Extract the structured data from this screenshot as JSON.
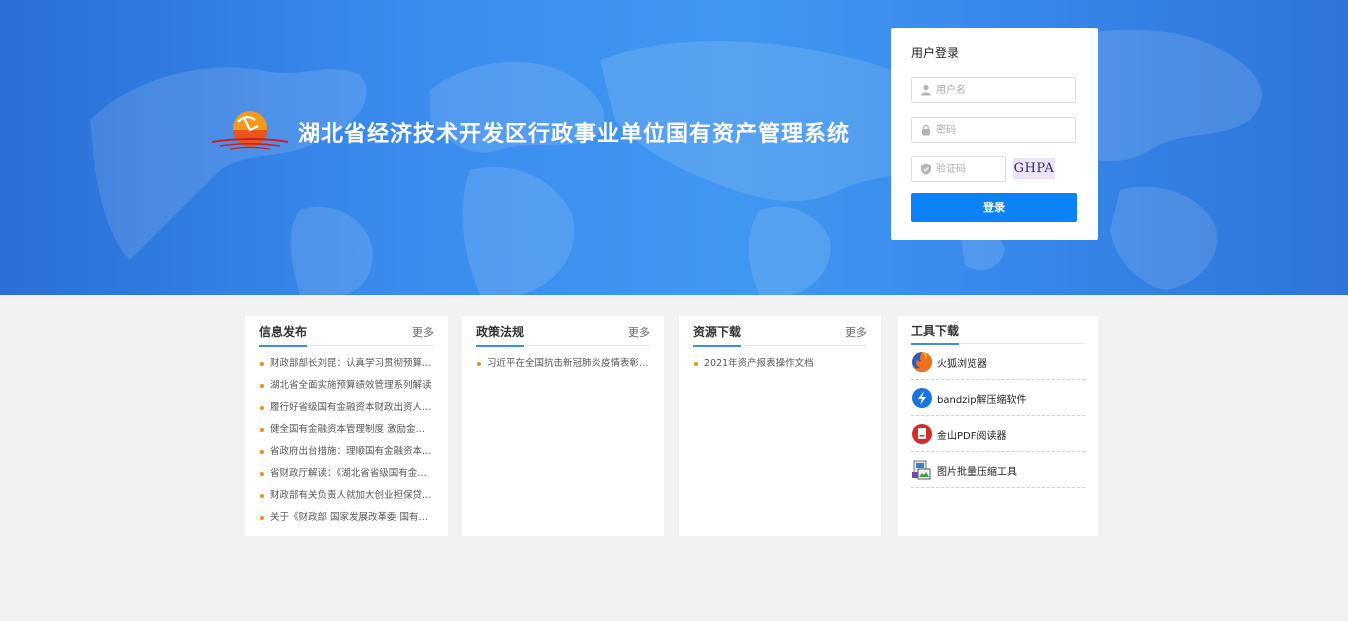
{
  "header": {
    "system_title": "湖北省经济技术开发区行政事业单位国有资产管理系统"
  },
  "login": {
    "title": "用户登录",
    "username_placeholder": "用户名",
    "password_placeholder": "密码",
    "captcha_placeholder": "验证码",
    "captcha_code": "GHPA",
    "submit_label": "登录"
  },
  "panels": {
    "info": {
      "title": "信息发布",
      "more": "更多",
      "items": [
        "财政部部长刘昆：认真学习贯彻预算法实施条例",
        "湖北省全面实施预算绩效管理系列解读",
        "履行好省级国有金融资本财政出资人职责",
        "健全国有金融资本管理制度 激励金融服务",
        "省政府出台措施：理顺国有金融资本管理体制",
        "省财政厅解读：《湖北省省级国有金融资本管理》",
        "财政部有关负责人就加大创业担保贷款政策",
        "关于《财政部 国家发展改革委 国有资产》"
      ]
    },
    "policy": {
      "title": "政策法规",
      "more": "更多",
      "items": [
        "习近平在全国抗击新冠肺炎疫情表彰大会上的讲话"
      ]
    },
    "resources": {
      "title": "资源下载",
      "more": "更多",
      "items": [
        "2021年资产报表操作文档"
      ]
    },
    "tools": {
      "title": "工具下载",
      "items": [
        {
          "label": "火狐浏览器",
          "icon": "firefox-icon"
        },
        {
          "label": "bandzip解压缩软件",
          "icon": "bandizip-icon"
        },
        {
          "label": "金山PDF阅读器",
          "icon": "pdf-reader-icon"
        },
        {
          "label": "图片批量压缩工具",
          "icon": "image-compress-icon"
        }
      ]
    }
  },
  "colors": {
    "banner": "#3b8cee",
    "accent": "#0b82f5",
    "bullet": "#f08a24"
  }
}
